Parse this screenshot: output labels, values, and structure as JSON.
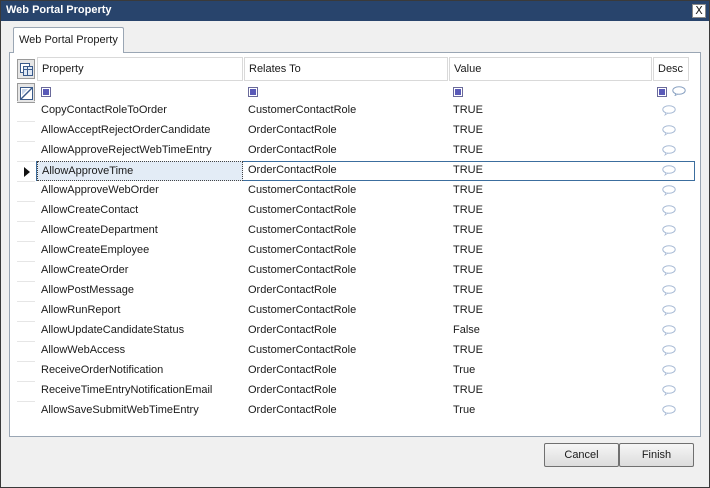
{
  "window": {
    "title": "Web Portal Property",
    "close_glyph": "X"
  },
  "tab": {
    "label": "Web Portal Property"
  },
  "grid": {
    "columns": {
      "property": "Property",
      "relates_to": "Relates To",
      "value": "Value",
      "desc": "Desc"
    },
    "icons": {
      "corner_top": "column-chooser-icon",
      "corner_bottom": "clear-filter-icon",
      "filter": "filter-checkbox-icon",
      "desc": "comment-bubble-icon"
    },
    "current_row_index": 3,
    "rows": [
      {
        "property": "CopyContactRoleToOrder",
        "relates_to": "CustomerContactRole",
        "value": "TRUE"
      },
      {
        "property": "AllowAcceptRejectOrderCandidate",
        "relates_to": "OrderContactRole",
        "value": "TRUE"
      },
      {
        "property": "AllowApproveRejectWebTimeEntry",
        "relates_to": "OrderContactRole",
        "value": "TRUE"
      },
      {
        "property": "AllowApproveTime",
        "relates_to": "OrderContactRole",
        "value": "TRUE"
      },
      {
        "property": "AllowApproveWebOrder",
        "relates_to": "CustomerContactRole",
        "value": "TRUE"
      },
      {
        "property": "AllowCreateContact",
        "relates_to": "CustomerContactRole",
        "value": "TRUE"
      },
      {
        "property": "AllowCreateDepartment",
        "relates_to": "CustomerContactRole",
        "value": "TRUE"
      },
      {
        "property": "AllowCreateEmployee",
        "relates_to": "CustomerContactRole",
        "value": "TRUE"
      },
      {
        "property": "AllowCreateOrder",
        "relates_to": "CustomerContactRole",
        "value": "TRUE"
      },
      {
        "property": "AllowPostMessage",
        "relates_to": "OrderContactRole",
        "value": "TRUE"
      },
      {
        "property": "AllowRunReport",
        "relates_to": "CustomerContactRole",
        "value": "TRUE"
      },
      {
        "property": "AllowUpdateCandidateStatus",
        "relates_to": "OrderContactRole",
        "value": "False"
      },
      {
        "property": "AllowWebAccess",
        "relates_to": "CustomerContactRole",
        "value": "TRUE"
      },
      {
        "property": "ReceiveOrderNotification",
        "relates_to": "OrderContactRole",
        "value": "True"
      },
      {
        "property": "ReceiveTimeEntryNotificationEmail",
        "relates_to": "OrderContactRole",
        "value": "TRUE"
      },
      {
        "property": "AllowSaveSubmitWebTimeEntry",
        "relates_to": "OrderContactRole",
        "value": "True"
      }
    ]
  },
  "buttons": {
    "cancel": "Cancel",
    "finish": "Finish"
  },
  "colors": {
    "titlebar": "#28446c",
    "selection_border": "#3c6e9e",
    "selection_fill": "#e3ecf6",
    "filter_check": "#5a5ab8"
  }
}
